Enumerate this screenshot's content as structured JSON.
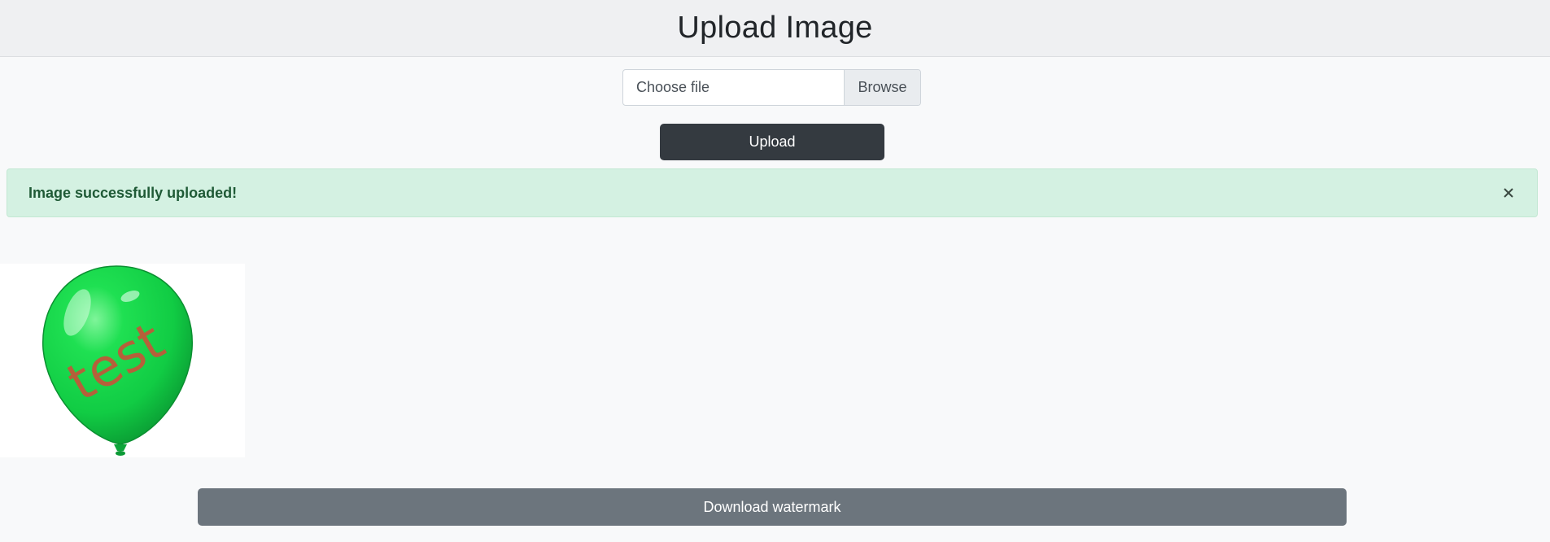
{
  "header": {
    "title": "Upload Image"
  },
  "upload_form": {
    "file_placeholder": "Choose file",
    "browse_label": "Browse",
    "upload_label": "Upload"
  },
  "alert": {
    "message": "Image successfully uploaded!",
    "close_icon": "close-icon"
  },
  "preview": {
    "watermark_text": "test",
    "balloon_color": "#11cc44",
    "watermark_color": "#b5603a"
  },
  "actions": {
    "download_label": "Download watermark"
  },
  "colors": {
    "dark_button": "#343a40",
    "secondary_button": "#6c757d",
    "success_bg": "#d4f1e2",
    "success_text": "#1f5a36"
  }
}
